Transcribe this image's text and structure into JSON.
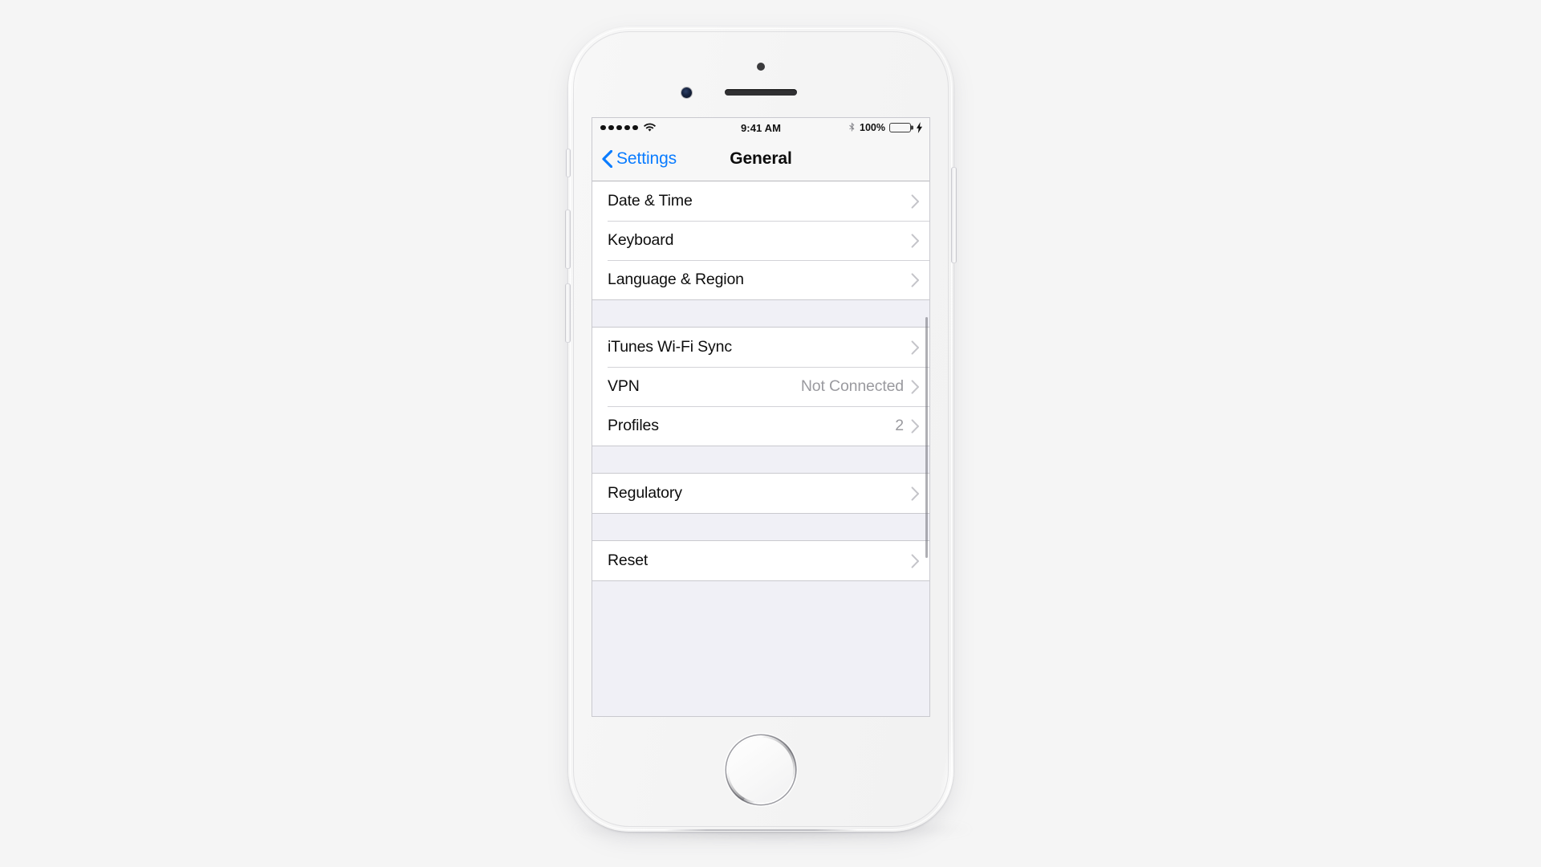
{
  "device": {
    "name": "iPhone",
    "color": "silver-white",
    "components": {
      "front_camera": "front-camera",
      "earpiece": "earpiece-speaker",
      "proximity_sensor": "proximity-sensor",
      "home_button": "home-button",
      "volume_up": "volume-up-button",
      "volume_down": "volume-down-button",
      "ring_silent": "ring-silent-switch",
      "power": "power-button"
    }
  },
  "status_bar": {
    "signal_dots": 5,
    "wifi_icon": "wifi-icon",
    "time": "9:41 AM",
    "bluetooth_icon": "bluetooth-icon",
    "battery_percent": "100%",
    "battery_level": 100,
    "battery_color": "#4cd763",
    "charging_icon": "lightning-bolt-icon"
  },
  "nav_bar": {
    "back_icon": "chevron-left-icon",
    "back_label": "Settings",
    "title": "General",
    "tint_color": "#0a7cff"
  },
  "table": {
    "chevron_icon": "chevron-right-icon",
    "background": "#f0f0f6",
    "groups": [
      {
        "id": "group-datetime",
        "rows": [
          {
            "label": "Date & Time",
            "detail": "",
            "accessory": "chevron-right-icon"
          },
          {
            "label": "Keyboard",
            "detail": "",
            "accessory": "chevron-right-icon"
          },
          {
            "label": "Language & Region",
            "detail": "",
            "accessory": "chevron-right-icon"
          }
        ]
      },
      {
        "id": "group-sync",
        "rows": [
          {
            "label": "iTunes Wi-Fi Sync",
            "detail": "",
            "accessory": "chevron-right-icon"
          },
          {
            "label": "VPN",
            "detail": "Not Connected",
            "accessory": "chevron-right-icon"
          },
          {
            "label": "Profiles",
            "detail": "2",
            "accessory": "chevron-right-icon"
          }
        ]
      },
      {
        "id": "group-regulatory",
        "rows": [
          {
            "label": "Regulatory",
            "detail": "",
            "accessory": "chevron-right-icon"
          }
        ]
      },
      {
        "id": "group-reset",
        "rows": [
          {
            "label": "Reset",
            "detail": "",
            "accessory": "chevron-right-icon"
          }
        ]
      }
    ]
  },
  "scroll": {
    "indicator": "vertical-scroll-indicator"
  },
  "page": {
    "background": "#f5f5f5"
  }
}
